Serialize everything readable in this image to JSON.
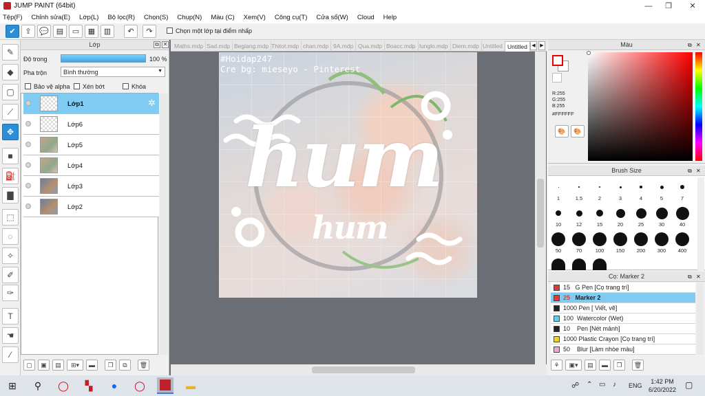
{
  "window": {
    "title": "JUMP PAINT (64bit)"
  },
  "menu": [
    "Tệp(F)",
    "Chỉnh sửa(E)",
    "Lớp(L)",
    "Bộ lọc(R)",
    "Chọn(S)",
    "Chụp(N)",
    "Màu (C)",
    "Xem(V)",
    "Công cụ(T)",
    "Cửa sổ(W)",
    "Cloud",
    "Help"
  ],
  "toolbar": {
    "select_layer_label": "Chọn một lớp tại điểm nhấp"
  },
  "layer_panel": {
    "title": "Lớp",
    "opacity_label": "Độ trong",
    "opacity_value": "100 %",
    "opacity_fraction": 1.0,
    "blend_label": "Pha trộn",
    "blend_value": "Bình thường",
    "protect_alpha": "Bảo vệ alpha",
    "clip": "Xén bớt",
    "lock": "Khóa",
    "layers": [
      {
        "name": "Lớp1",
        "selected": true
      },
      {
        "name": "Lớp6",
        "selected": false
      },
      {
        "name": "Lớp5",
        "selected": false
      },
      {
        "name": "Lớp4",
        "selected": false
      },
      {
        "name": "Lớp3",
        "selected": false
      },
      {
        "name": "Lớp2",
        "selected": false
      }
    ]
  },
  "tabs": [
    "Maths.mdp",
    "Sad.mdp",
    "Begiang.mdp",
    "Thitot.mdp",
    "chan.mdp",
    "9A.mdp",
    "Qua.mdp",
    "Boacc.mdp",
    "lunglo.mdp",
    "Diem.mdp",
    "Untitled",
    "Untitled"
  ],
  "canvas": {
    "watermark1": "#Hoidap247",
    "watermark2": "Cre bg: mieseyo - Pinterest",
    "big_word": "hum",
    "small_word": "hum"
  },
  "color_panel": {
    "title": "Màu",
    "r": "R:255",
    "g": "G:255",
    "b": "B:255",
    "hex": "#FFFFFF",
    "primary": "#ff0000",
    "secondary": "#ffffff"
  },
  "brush_size": {
    "title": "Brush Size",
    "sizes": [
      "1",
      "1.5",
      "2",
      "3",
      "4",
      "5",
      "7",
      "10",
      "12",
      "15",
      "20",
      "25",
      "30",
      "40",
      "50",
      "70",
      "100",
      "150",
      "200",
      "300",
      "400"
    ]
  },
  "brush_panel": {
    "title": "Cọ: Marker 2",
    "items": [
      {
        "size": "15",
        "name": "G Pen [Cọ trang trí]",
        "color": "#e53935"
      },
      {
        "size": "25",
        "name": "Marker 2",
        "color": "#e53935",
        "selected": true
      },
      {
        "size": "1000",
        "name": "Pen [ Viết, vẽ]",
        "color": "#222222"
      },
      {
        "size": "100",
        "name": "Watercolor (Wet)",
        "color": "#5ecff0"
      },
      {
        "size": "10",
        "name": "Pen [Nét mảnh]",
        "color": "#222222"
      },
      {
        "size": "1000",
        "name": "Plastic Crayon [Cọ trang trí]",
        "color": "#f2d21a"
      },
      {
        "size": "50",
        "name": "Blur [Làm nhòe màu]",
        "color": "#f5a6d0"
      }
    ]
  },
  "taskbar": {
    "lang": "ENG",
    "time": "1:42 PM",
    "date": "6/20/2022"
  }
}
